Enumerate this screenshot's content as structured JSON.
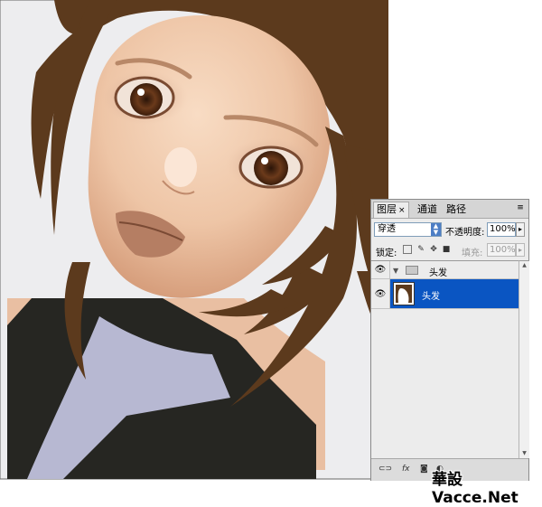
{
  "layers_panel": {
    "tabs": [
      {
        "label": "图层",
        "active": true
      },
      {
        "label": "通道",
        "active": false
      },
      {
        "label": "路径",
        "active": false
      }
    ],
    "tab_close": "×",
    "panel_menu": "≡",
    "blend_mode": "穿透",
    "opacity_label": "不透明度:",
    "opacity_value": "100%",
    "lock_label": "锁定:",
    "fill_label": "填充:",
    "fill_value": "100%",
    "group_name": "头发",
    "layer_name": "头发"
  },
  "watermark": "華設Vacce.Net",
  "colors": {
    "hair": "#5c3a1d",
    "skin": "#ecc6a8",
    "collar": "#b7b8d2",
    "shirt": "#262622",
    "selection": "#0a55c2",
    "background": "#ededed"
  }
}
